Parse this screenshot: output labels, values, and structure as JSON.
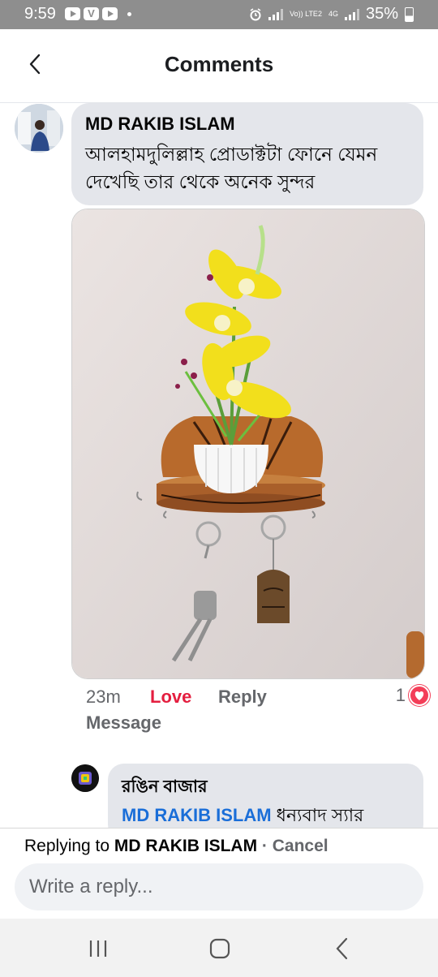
{
  "status_bar": {
    "time": "9:59",
    "volte": "Vo)) LTE2",
    "network": "4G",
    "battery": "35%"
  },
  "header": {
    "title": "Comments"
  },
  "comment": {
    "author": "MD RAKIB ISLAM",
    "text": "আলহামদুলিল্লাহ প্রোডাক্টটা ফোনে যেমন দেখেছি তার থেকে অনেক সুন্দর",
    "time": "23m",
    "love_label": "Love",
    "reply_label": "Reply",
    "message_label": "Message",
    "reaction_count": "1"
  },
  "reply": {
    "author": "রঙিন বাজার",
    "mention": "MD RAKIB ISLAM",
    "text": "ধন্যবাদ স্যার"
  },
  "composer": {
    "replying_prefix": "Replying to",
    "replying_to": "MD RAKIB ISLAM",
    "separator": "·",
    "cancel_label": "Cancel",
    "placeholder": "Write a reply..."
  },
  "colors": {
    "love": "#e41e3f",
    "mention": "#1a6ed8",
    "bubble": "#e4e6eb"
  }
}
